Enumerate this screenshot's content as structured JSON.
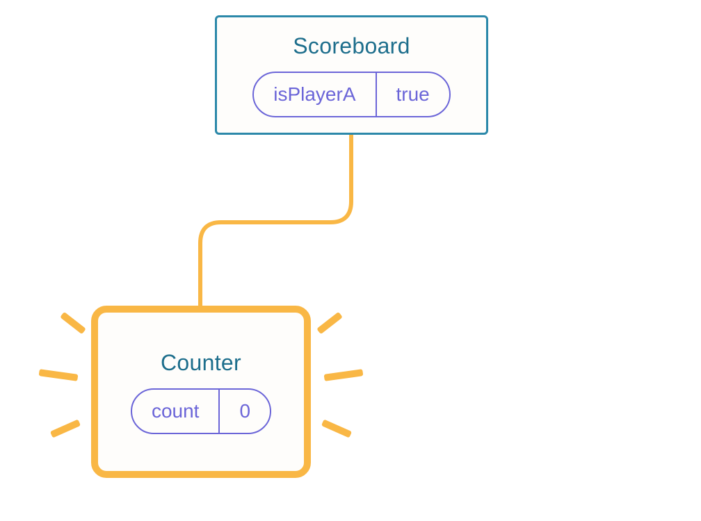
{
  "nodes": {
    "top": {
      "title": "Scoreboard",
      "state_key": "isPlayerA",
      "state_value": "true"
    },
    "bottom": {
      "title": "Counter",
      "state_key": "count",
      "state_value": "0"
    }
  },
  "colors": {
    "top_border": "#2b88a9",
    "title": "#1d6e8c",
    "pill": "#6b65d8",
    "highlight": "#f9b745",
    "connector": "#f9b745"
  }
}
